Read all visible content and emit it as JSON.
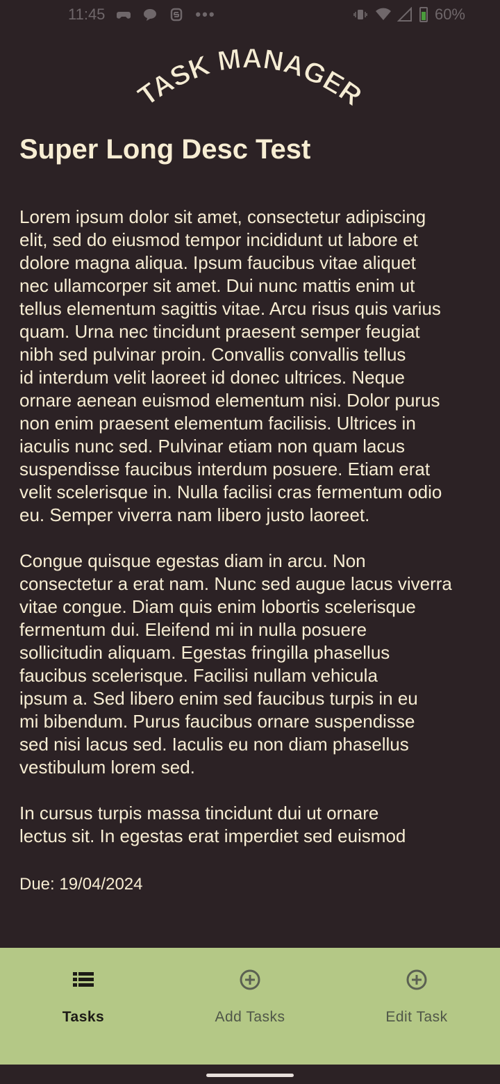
{
  "status_bar": {
    "time": "11:45",
    "more_dots": "•••",
    "battery_percent": "60%"
  },
  "app": {
    "logo_text": "TASK MANAGER"
  },
  "task": {
    "title": "Super Long Desc Test",
    "description_paragraphs": [
      "Lorem ipsum dolor sit amet, consectetur adipiscing\nelit, sed do eiusmod tempor incididunt ut labore et\ndolore magna aliqua. Ipsum faucibus vitae aliquet\nnec ullamcorper sit amet. Dui nunc mattis enim ut\ntellus elementum sagittis vitae. Arcu risus quis varius\nquam. Urna nec tincidunt praesent semper feugiat\nnibh sed pulvinar proin. Convallis convallis tellus\nid interdum velit laoreet id donec ultrices. Neque\nornare aenean euismod elementum nisi. Dolor purus\nnon enim praesent elementum facilisis. Ultrices in\niaculis nunc sed. Pulvinar etiam non quam lacus\nsuspendisse faucibus interdum posuere. Etiam erat\nvelit scelerisque in. Nulla facilisi cras fermentum odio\neu. Semper viverra nam libero justo laoreet.",
      "Congue quisque egestas diam in arcu. Non\nconsectetur a erat nam. Nunc sed augue lacus viverra\nvitae congue. Diam quis enim lobortis scelerisque\nfermentum dui. Eleifend mi in nulla posuere\nsollicitudin aliquam. Egestas fringilla phasellus\nfaucibus scelerisque. Facilisi nullam vehicula\nipsum a. Sed libero enim sed faucibus turpis in eu\nmi bibendum. Purus faucibus ornare suspendisse\nsed nisi lacus sed. Iaculis eu non diam phasellus\nvestibulum lorem sed.",
      "In cursus turpis massa tincidunt dui ut ornare\nlectus sit. In egestas erat imperdiet sed euismod\nnisi porta lorem mollis. Blandit massa enim nec"
    ],
    "due": "Due: 19/04/2024"
  },
  "bottom_nav": {
    "items": [
      {
        "label": "Tasks",
        "icon": "list-icon",
        "active": true
      },
      {
        "label": "Add Tasks",
        "icon": "add-circle-icon",
        "active": false
      },
      {
        "label": "Edit Task",
        "icon": "add-circle-icon",
        "active": false
      }
    ]
  },
  "colors": {
    "background": "#2c2225",
    "text": "#f7edd3",
    "nav_background": "#b4c886"
  }
}
